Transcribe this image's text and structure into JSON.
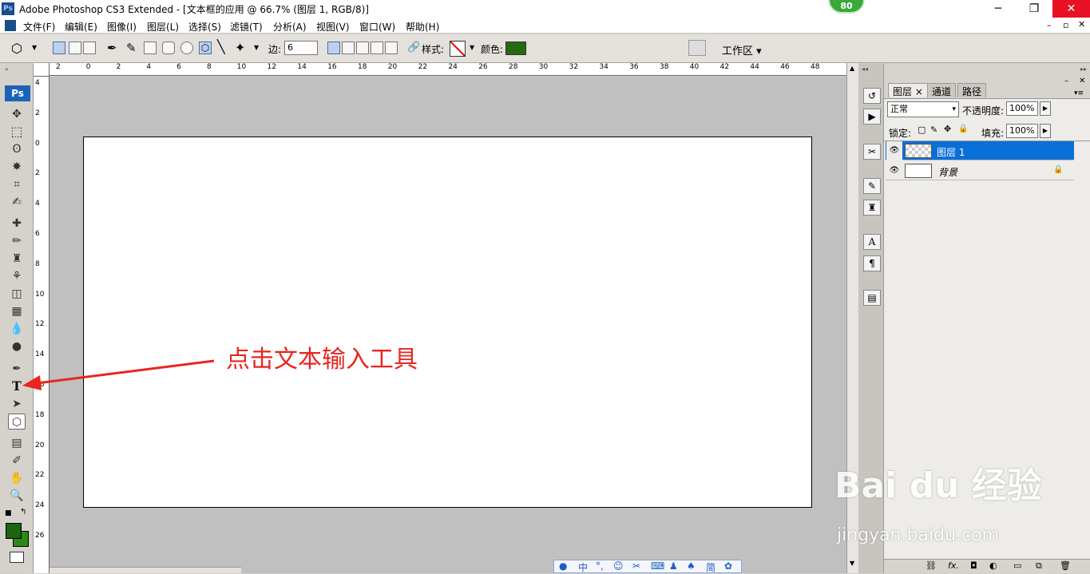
{
  "window": {
    "title": "Adobe Photoshop CS3 Extended - [文本框的应用 @ 66.7% (图层 1, RGB/8)]",
    "app_icon": "Ps",
    "badge": "80"
  },
  "menu": [
    "文件(F)",
    "编辑(E)",
    "图像(I)",
    "图层(L)",
    "选择(S)",
    "滤镜(T)",
    "分析(A)",
    "视图(V)",
    "窗口(W)",
    "帮助(H)"
  ],
  "options": {
    "sides_label": "边:",
    "sides_value": "6",
    "style_label": "样式:",
    "color_label": "颜色:",
    "color_value": "#236b0f",
    "workspace_label": "工作区 ▾"
  },
  "ruler_top": [
    "2",
    "0",
    "2",
    "4",
    "6",
    "8",
    "10",
    "12",
    "14",
    "16",
    "18",
    "20",
    "22",
    "24",
    "26",
    "28",
    "30",
    "32",
    "34",
    "36",
    "38",
    "40",
    "42",
    "44",
    "46",
    "48"
  ],
  "ruler_left": [
    "4",
    "2",
    "0",
    "2",
    "4",
    "6",
    "8",
    "10",
    "12",
    "14",
    "16",
    "18",
    "20",
    "22",
    "24",
    "26"
  ],
  "layers_panel": {
    "tabs": [
      "图层",
      "通道",
      "路径"
    ],
    "blend_mode": "正常",
    "opacity_label": "不透明度:",
    "opacity_value": "100%",
    "lock_label": "锁定:",
    "fill_label": "填充:",
    "fill_value": "100%",
    "layers": [
      {
        "name": "图层 1",
        "selected": true
      },
      {
        "name": "背景",
        "selected": false
      }
    ]
  },
  "annotation": "点击文本输入工具",
  "watermark": {
    "brand": "Bai du 经验",
    "url": "jingyan.baidu.com"
  },
  "ime": {
    "labels": [
      "中",
      "简"
    ]
  }
}
